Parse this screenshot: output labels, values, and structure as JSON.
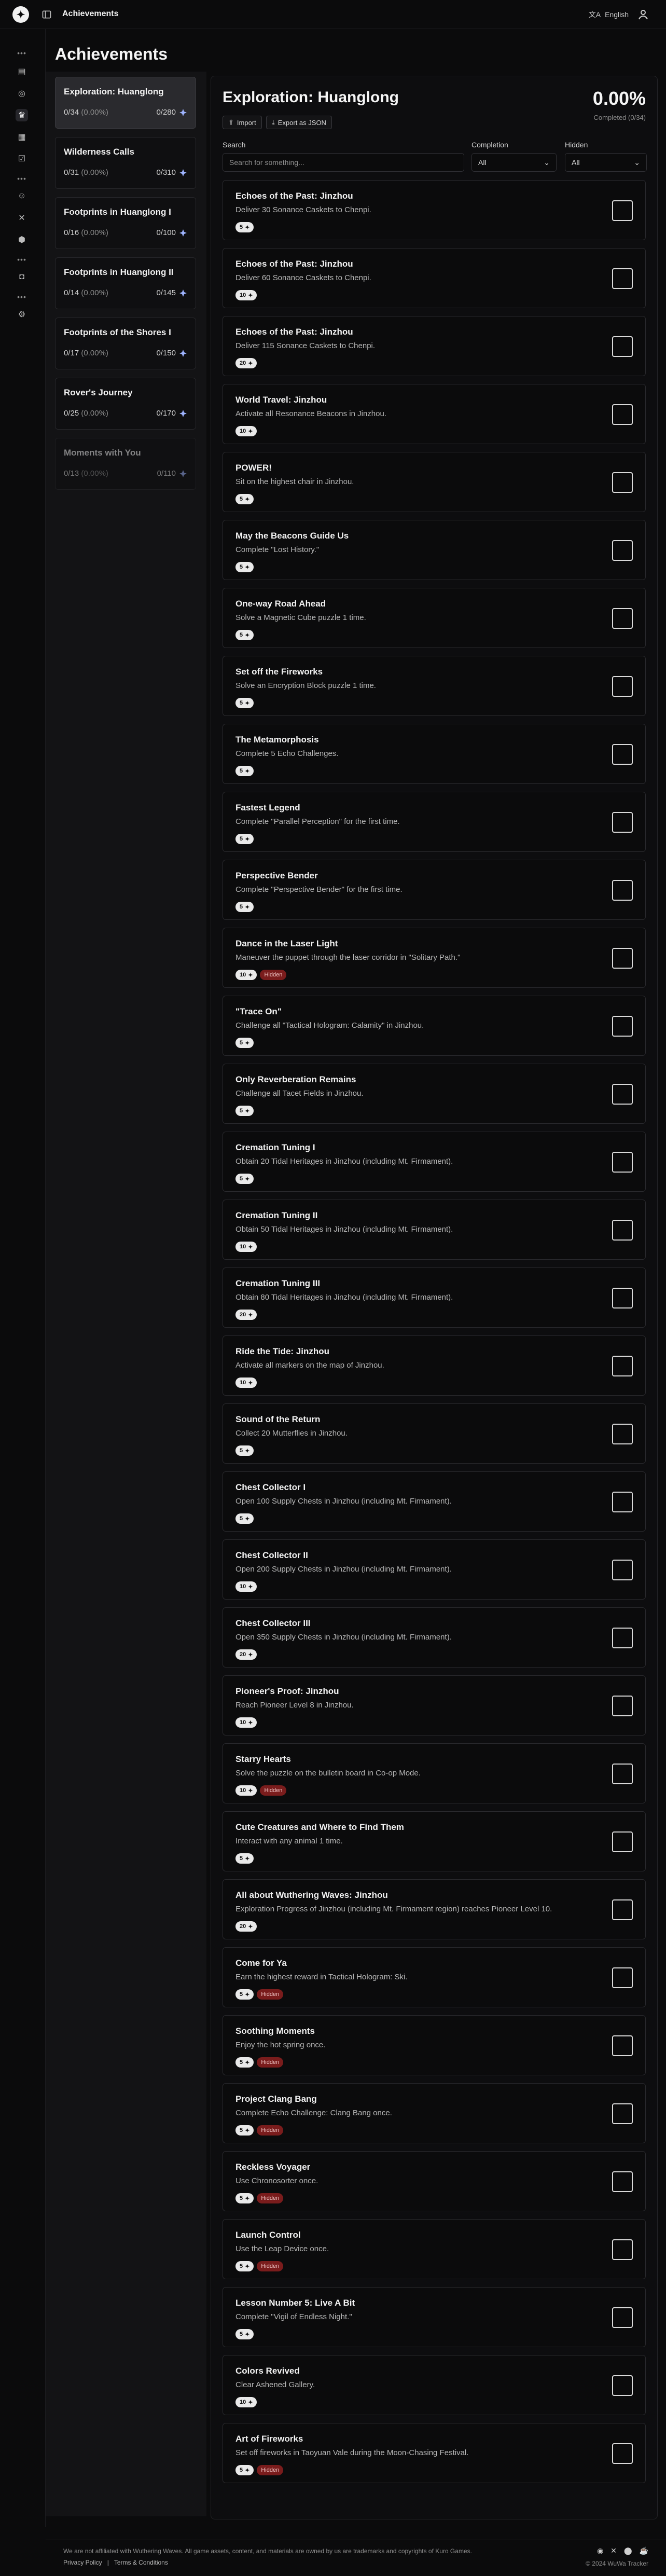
{
  "topbar": {
    "title": "Achievements",
    "language": "English"
  },
  "page_title": "Achievements",
  "categories": [
    {
      "name": "Exploration: Huanglong",
      "progress": "0/34",
      "percent": "(0.00%)",
      "points": "0/280"
    },
    {
      "name": "Wilderness Calls",
      "progress": "0/31",
      "percent": "(0.00%)",
      "points": "0/310"
    },
    {
      "name": "Footprints in Huanglong I",
      "progress": "0/16",
      "percent": "(0.00%)",
      "points": "0/100"
    },
    {
      "name": "Footprints in Huanglong II",
      "progress": "0/14",
      "percent": "(0.00%)",
      "points": "0/145"
    },
    {
      "name": "Footprints of the Shores I",
      "progress": "0/17",
      "percent": "(0.00%)",
      "points": "0/150"
    },
    {
      "name": "Rover's Journey",
      "progress": "0/25",
      "percent": "(0.00%)",
      "points": "0/170"
    },
    {
      "name": "Moments with You",
      "progress": "0/13",
      "percent": "(0.00%)",
      "points": "0/110"
    }
  ],
  "detail": {
    "title": "Exploration: Huanglong",
    "percent": "0.00%",
    "completed": "Completed (0/34)",
    "import_label": "Import",
    "export_label": "Export as JSON",
    "search_label": "Search",
    "search_placeholder": "Search for something...",
    "completion_label": "Completion",
    "completion_value": "All",
    "hidden_label": "Hidden",
    "hidden_value": "All"
  },
  "hidden_tag": "Hidden",
  "achievements": [
    {
      "name": "Echoes of the Past: Jinzhou",
      "desc": "Deliver 30 Sonance Caskets to Chenpi.",
      "points": "5",
      "hidden": false
    },
    {
      "name": "Echoes of the Past: Jinzhou",
      "desc": "Deliver 60 Sonance Caskets to Chenpi.",
      "points": "10",
      "hidden": false
    },
    {
      "name": "Echoes of the Past: Jinzhou",
      "desc": "Deliver 115 Sonance Caskets to Chenpi.",
      "points": "20",
      "hidden": false
    },
    {
      "name": "World Travel: Jinzhou",
      "desc": "Activate all Resonance Beacons in Jinzhou.",
      "points": "10",
      "hidden": false
    },
    {
      "name": "POWER!",
      "desc": "Sit on the highest chair in Jinzhou.",
      "points": "5",
      "hidden": false
    },
    {
      "name": "May the Beacons Guide Us",
      "desc": "Complete \"Lost History.\"",
      "points": "5",
      "hidden": false
    },
    {
      "name": "One-way Road Ahead",
      "desc": "Solve a Magnetic Cube puzzle 1 time.",
      "points": "5",
      "hidden": false
    },
    {
      "name": "Set off the Fireworks",
      "desc": "Solve an Encryption Block puzzle 1 time.",
      "points": "5",
      "hidden": false
    },
    {
      "name": "The Metamorphosis",
      "desc": "Complete 5 Echo Challenges.",
      "points": "5",
      "hidden": false
    },
    {
      "name": "Fastest Legend",
      "desc": "Complete \"Parallel Perception\" for the first time.",
      "points": "5",
      "hidden": false
    },
    {
      "name": "Perspective Bender",
      "desc": "Complete \"Perspective Bender\" for the first time.",
      "points": "5",
      "hidden": false
    },
    {
      "name": "Dance in the Laser Light",
      "desc": "Maneuver the puppet through the laser corridor in \"Solitary Path.\"",
      "points": "10",
      "hidden": true
    },
    {
      "name": "\"Trace On\"",
      "desc": "Challenge all \"Tactical Hologram: Calamity\" in Jinzhou.",
      "points": "5",
      "hidden": false
    },
    {
      "name": "Only Reverberation Remains",
      "desc": "Challenge all Tacet Fields in Jinzhou.",
      "points": "5",
      "hidden": false
    },
    {
      "name": "Cremation Tuning I",
      "desc": "Obtain 20 Tidal Heritages in Jinzhou (including Mt. Firmament).",
      "points": "5",
      "hidden": false
    },
    {
      "name": "Cremation Tuning II",
      "desc": "Obtain 50 Tidal Heritages in Jinzhou (including Mt. Firmament).",
      "points": "10",
      "hidden": false
    },
    {
      "name": "Cremation Tuning III",
      "desc": "Obtain 80 Tidal Heritages in Jinzhou (including Mt. Firmament).",
      "points": "20",
      "hidden": false
    },
    {
      "name": "Ride the Tide: Jinzhou",
      "desc": "Activate all markers on the map of Jinzhou.",
      "points": "10",
      "hidden": false
    },
    {
      "name": "Sound of the Return",
      "desc": "Collect 20 Mutterflies in Jinzhou.",
      "points": "5",
      "hidden": false
    },
    {
      "name": "Chest Collector I",
      "desc": "Open 100 Supply Chests in Jinzhou (including Mt. Firmament).",
      "points": "5",
      "hidden": false
    },
    {
      "name": "Chest Collector II",
      "desc": "Open 200 Supply Chests in Jinzhou (including Mt. Firmament).",
      "points": "10",
      "hidden": false
    },
    {
      "name": "Chest Collector III",
      "desc": "Open 350 Supply Chests in Jinzhou (including Mt. Firmament).",
      "points": "20",
      "hidden": false
    },
    {
      "name": "Pioneer's Proof: Jinzhou",
      "desc": "Reach Pioneer Level 8 in Jinzhou.",
      "points": "10",
      "hidden": false
    },
    {
      "name": "Starry Hearts",
      "desc": "Solve the puzzle on the bulletin board in Co-op Mode.",
      "points": "10",
      "hidden": true
    },
    {
      "name": "Cute Creatures and Where to Find Them",
      "desc": "Interact with any animal 1 time.",
      "points": "5",
      "hidden": false
    },
    {
      "name": "All about Wuthering Waves: Jinzhou",
      "desc": "Exploration Progress of Jinzhou (including Mt. Firmament region) reaches Pioneer Level 10.",
      "points": "20",
      "hidden": false
    },
    {
      "name": "Come for Ya",
      "desc": "Earn the highest reward in Tactical Hologram: Ski.",
      "points": "5",
      "hidden": true
    },
    {
      "name": "Soothing Moments",
      "desc": "Enjoy the hot spring once.",
      "points": "5",
      "hidden": true
    },
    {
      "name": "Project Clang Bang",
      "desc": "Complete Echo Challenge: Clang Bang once.",
      "points": "5",
      "hidden": true
    },
    {
      "name": "Reckless Voyager",
      "desc": "Use Chronosorter once.",
      "points": "5",
      "hidden": true
    },
    {
      "name": "Launch Control",
      "desc": "Use the Leap Device once.",
      "points": "5",
      "hidden": true
    },
    {
      "name": "Lesson Number 5: Live A Bit",
      "desc": "Complete \"Vigil of Endless Night.\"",
      "points": "5",
      "hidden": false
    },
    {
      "name": "Colors Revived",
      "desc": "Clear Ashened Gallery.",
      "points": "10",
      "hidden": false
    },
    {
      "name": "Art of Fireworks",
      "desc": "Set off fireworks in Taoyuan Vale during the Moon-Chasing Festival.",
      "points": "5",
      "hidden": true
    }
  ],
  "footer": {
    "disclaimer": "We are not affiliated with Wuthering Waves. All game assets, content, and materials are owned by us are trademarks and copyrights of Kuro Games.",
    "privacy": "Privacy Policy",
    "separator": "|",
    "terms": "Terms & Conditions",
    "copyright": "© 2024 WuWa Tracker"
  }
}
